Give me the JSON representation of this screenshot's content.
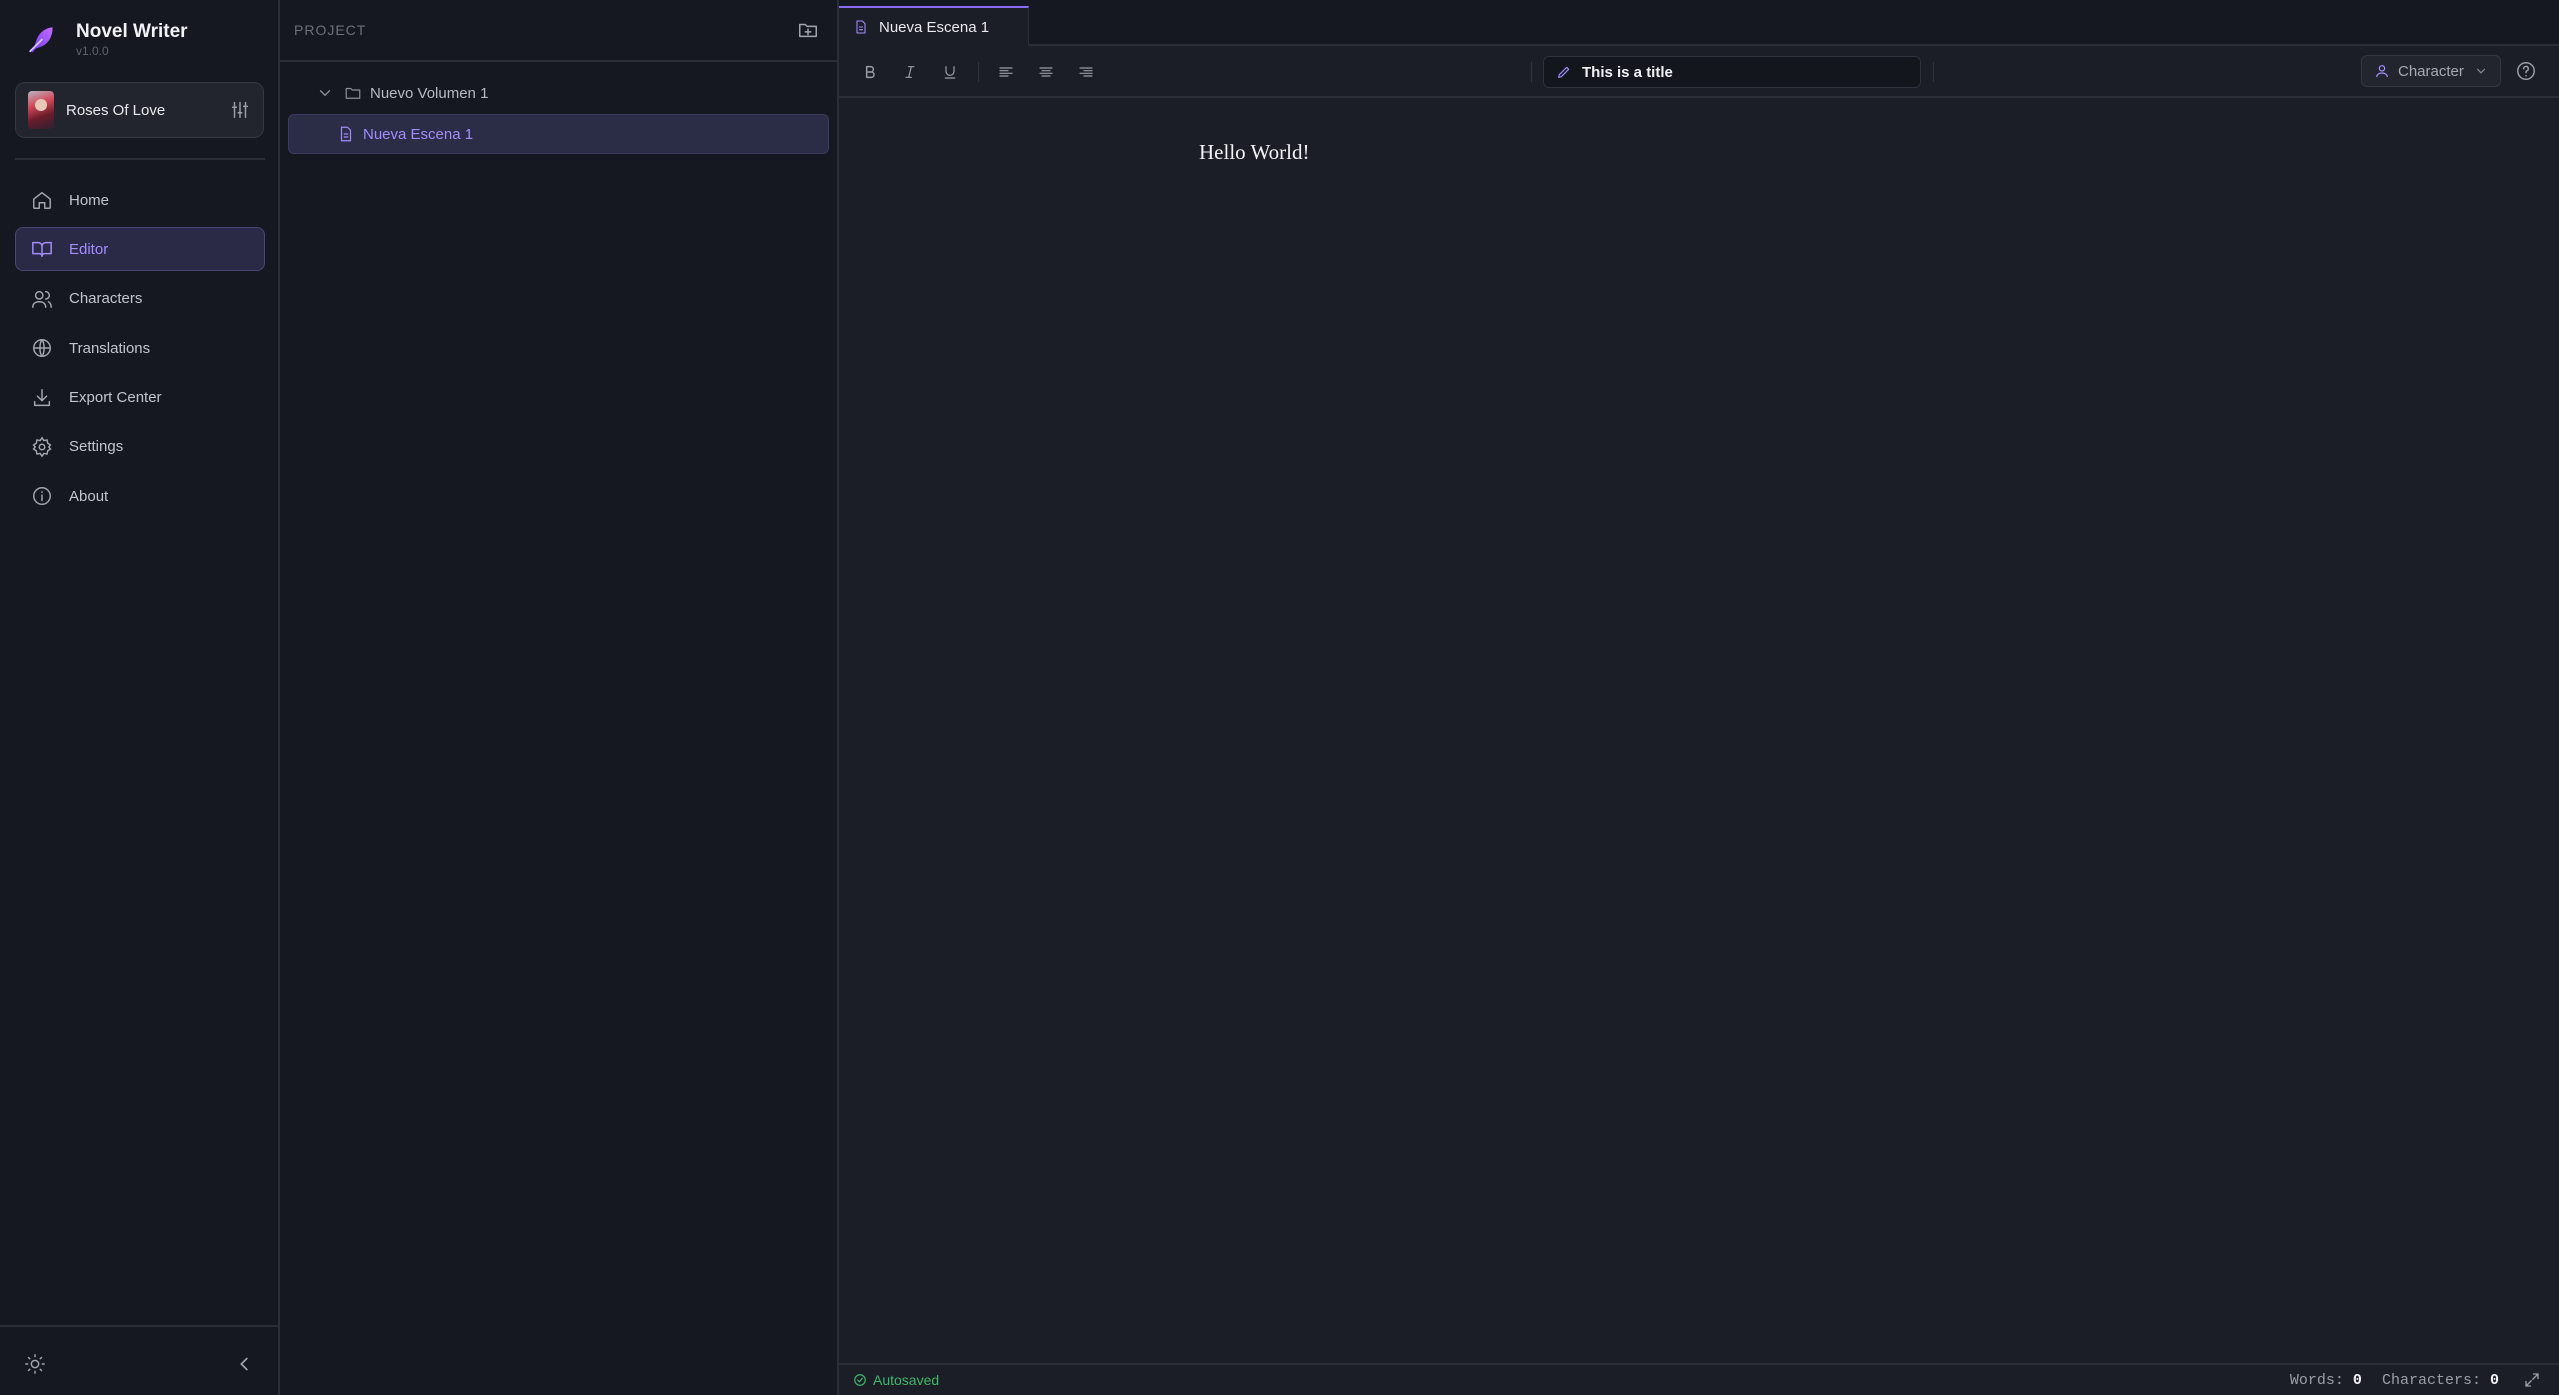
{
  "app": {
    "title": "Novel Writer",
    "version": "v1.0.0"
  },
  "project": {
    "name": "Roses Of Love"
  },
  "nav": {
    "items": [
      {
        "label": "Home",
        "icon": "home-icon"
      },
      {
        "label": "Editor",
        "icon": "book-open-icon",
        "active": true
      },
      {
        "label": "Characters",
        "icon": "users-icon"
      },
      {
        "label": "Translations",
        "icon": "globe-icon"
      },
      {
        "label": "Export Center",
        "icon": "download-icon"
      },
      {
        "label": "Settings",
        "icon": "gear-icon"
      },
      {
        "label": "About",
        "icon": "info-icon"
      }
    ]
  },
  "tree": {
    "header": "PROJECT",
    "volume": "Nuevo Volumen 1",
    "scene": "Nueva Escena 1"
  },
  "editor": {
    "tab_label": "Nueva Escena 1",
    "title_value": "This is a title",
    "character_select": "Character",
    "content": "Hello World!",
    "status": {
      "autosave": "Autosaved",
      "words_label": "Words:",
      "words": "0",
      "chars_label": "Characters:",
      "chars": "0"
    }
  },
  "colors": {
    "accent": "#a48cff",
    "background": "#1b1e26",
    "sidebar": "#151820",
    "success": "#3fb96a"
  }
}
